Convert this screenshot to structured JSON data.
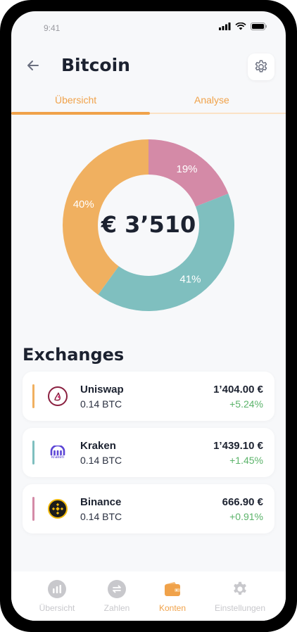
{
  "status": {
    "time": "9:41"
  },
  "header": {
    "title": "Bitcoin"
  },
  "tabs": [
    {
      "label": "Übersicht",
      "active": true
    },
    {
      "label": "Analyse",
      "active": false
    }
  ],
  "chart_data": {
    "type": "pie",
    "donut": true,
    "center_label": "€ 3’510",
    "slices": [
      {
        "label": "19%",
        "value": 19,
        "color": "#d48aa7"
      },
      {
        "label": "41%",
        "value": 41,
        "color": "#7fbfbf"
      },
      {
        "label": "40%",
        "value": 40,
        "color": "#f0b060"
      }
    ]
  },
  "exchanges": {
    "title": "Exchanges",
    "items": [
      {
        "name": "Uniswap",
        "amount": "0.14 BTC",
        "value": "1’404.00 €",
        "change": "+5.24%",
        "accent": "#f0b060",
        "icon": "uniswap-icon"
      },
      {
        "name": "Kraken",
        "amount": "0.14 BTC",
        "value": "1’439.10 €",
        "change": "+1.45%",
        "accent": "#7fbfbf",
        "icon": "kraken-icon",
        "icon_text": "kraken"
      },
      {
        "name": "Binance",
        "amount": "0.14 BTC",
        "value": "666.90 €",
        "change": "+0.91%",
        "accent": "#d48aa7",
        "icon": "binance-icon"
      }
    ]
  },
  "nav": {
    "items": [
      {
        "label": "Übersicht",
        "icon": "chart-icon",
        "active": false
      },
      {
        "label": "Zahlen",
        "icon": "transfer-icon",
        "active": false
      },
      {
        "label": "Konten",
        "icon": "wallet-icon",
        "active": true
      },
      {
        "label": "Einstellungen",
        "icon": "gear-icon",
        "active": false
      }
    ]
  },
  "colors": {
    "accent": "#f0a24a",
    "positive": "#5bb36a",
    "text": "#1c2230",
    "inactive": "#c8c8cc"
  }
}
